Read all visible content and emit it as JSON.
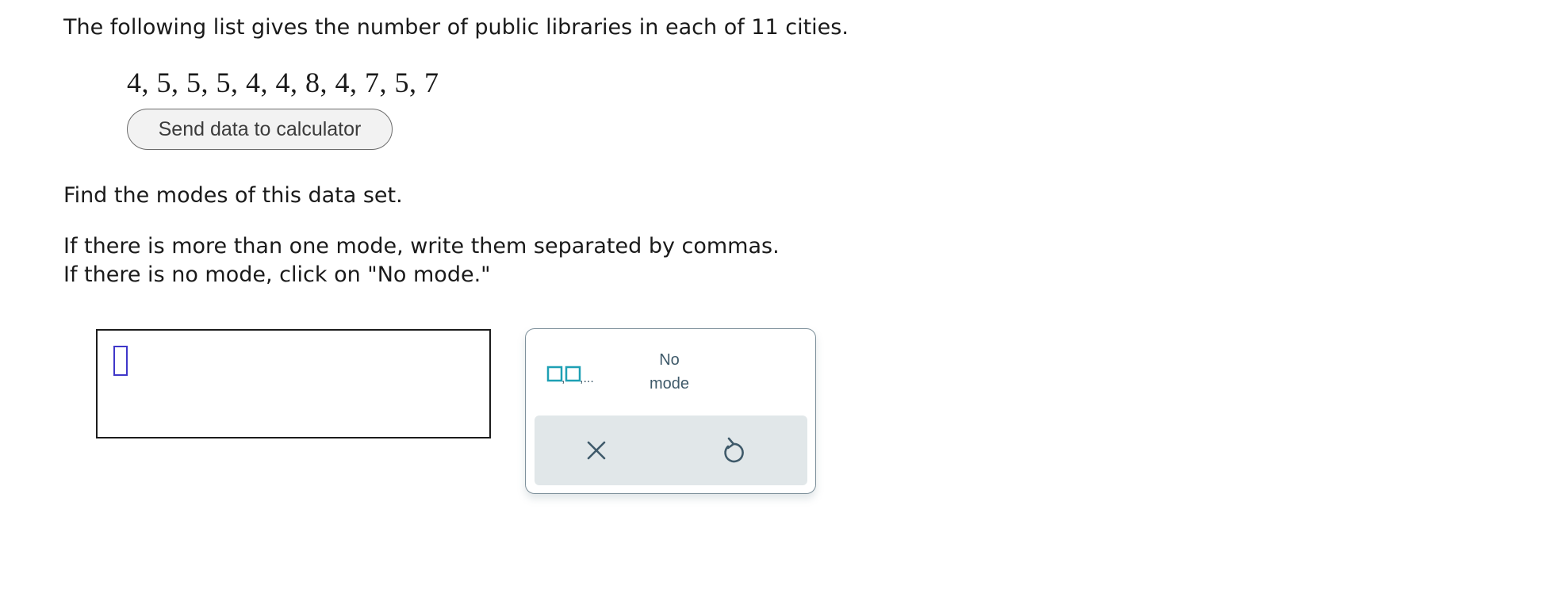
{
  "problem": {
    "intro": "The following list gives the number of public libraries in each of 11 cities.",
    "data_list": "4, 5, 5, 5, 4, 4, 8, 4, 7, 5, 7",
    "send_button_label": "Send data to calculator",
    "question": "Find the modes of this data set.",
    "instruction_line1": "If there is more than one mode, write them separated by commas.",
    "instruction_line2": "If there is no mode, click on \"No mode.\""
  },
  "answer": {
    "value": ""
  },
  "keypad": {
    "list_template_icon": "comma-list-icon",
    "no_mode_line1": "No",
    "no_mode_line2": "mode",
    "clear_icon": "close-icon",
    "undo_icon": "undo-icon",
    "colors": {
      "accent": "#1ea0b4",
      "icon": "#3f5a6a",
      "tray": "#e1e7e9",
      "cursor": "#3f37c9"
    }
  }
}
